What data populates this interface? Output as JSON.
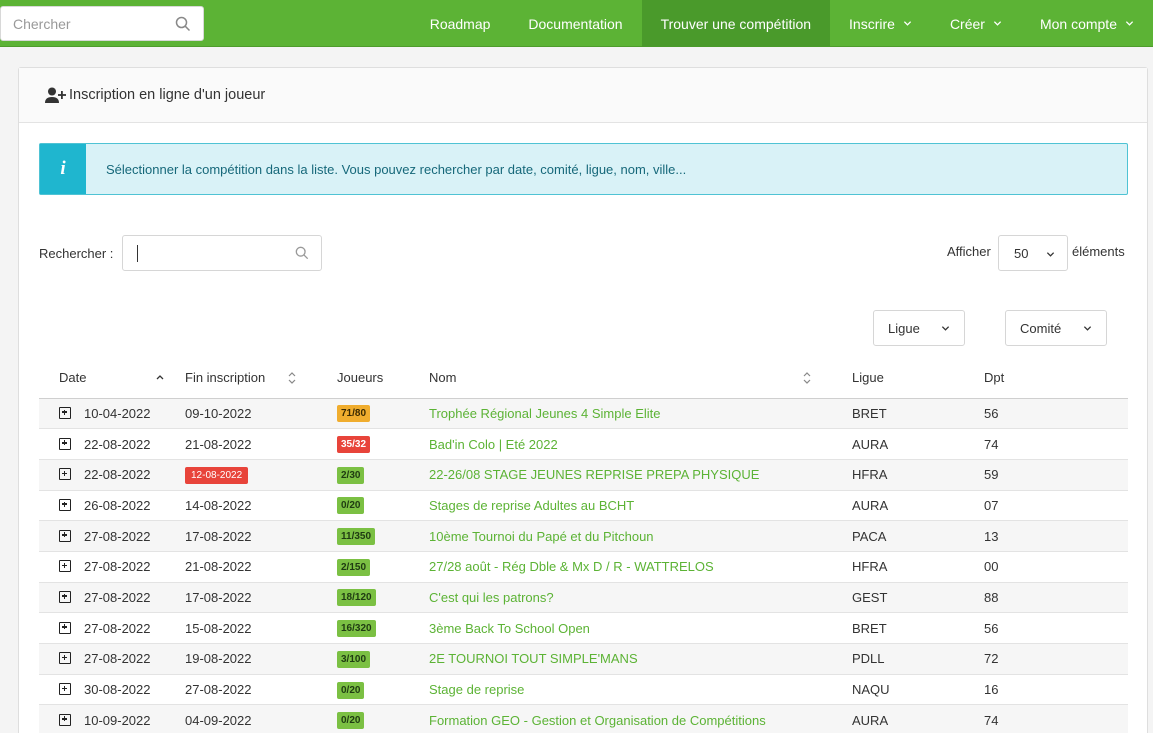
{
  "nav": {
    "search_placeholder": "Chercher",
    "items": [
      {
        "label": "Roadmap",
        "active": false,
        "dropdown": false
      },
      {
        "label": "Documentation",
        "active": false,
        "dropdown": false
      },
      {
        "label": "Trouver une compétition",
        "active": true,
        "dropdown": false
      },
      {
        "label": "Inscrire",
        "active": false,
        "dropdown": true
      },
      {
        "label": "Créer",
        "active": false,
        "dropdown": true
      },
      {
        "label": "Mon compte",
        "active": false,
        "dropdown": true
      }
    ]
  },
  "card": {
    "title": "Inscription en ligne d'un joueur",
    "alert_text": "Sélectionner la compétition dans la liste. Vous pouvez rechercher par date, comité, ligue, nom, ville...",
    "search_label": "Rechercher :",
    "search_value": "",
    "show_label": "Afficher",
    "page_length": "50",
    "elements_label": "éléments",
    "filter_ligue": "Ligue",
    "filter_comite": "Comité"
  },
  "table": {
    "columns": [
      "Date",
      "Fin inscription",
      "Joueurs",
      "Nom",
      "Ligue",
      "Dpt"
    ],
    "rows": [
      {
        "date": "10-04-2022",
        "fin": "09-10-2022",
        "fin_expired": false,
        "joueurs": "71/80",
        "status": "orange",
        "nom": "Trophée Régional Jeunes 4 Simple Elite",
        "ligue": "BRET",
        "dpt": "56"
      },
      {
        "date": "22-08-2022",
        "fin": "21-08-2022",
        "fin_expired": false,
        "joueurs": "35/32",
        "status": "red",
        "nom": "Bad'in Colo | Eté 2022",
        "ligue": "AURA",
        "dpt": "74"
      },
      {
        "date": "22-08-2022",
        "fin": "12-08-2022",
        "fin_expired": true,
        "joueurs": "2/30",
        "status": "green",
        "nom": "22-26/08 STAGE JEUNES REPRISE PREPA PHYSIQUE",
        "ligue": "HFRA",
        "dpt": "59"
      },
      {
        "date": "26-08-2022",
        "fin": "14-08-2022",
        "fin_expired": false,
        "joueurs": "0/20",
        "status": "green",
        "nom": "Stages de reprise Adultes au BCHT",
        "ligue": "AURA",
        "dpt": "07"
      },
      {
        "date": "27-08-2022",
        "fin": "17-08-2022",
        "fin_expired": false,
        "joueurs": "11/350",
        "status": "green",
        "nom": "10ème Tournoi du Papé et du Pitchoun",
        "ligue": "PACA",
        "dpt": "13"
      },
      {
        "date": "27-08-2022",
        "fin": "21-08-2022",
        "fin_expired": false,
        "joueurs": "2/150",
        "status": "green",
        "nom": "27/28 août - Rég Dble & Mx D / R - WATTRELOS",
        "ligue": "HFRA",
        "dpt": "00"
      },
      {
        "date": "27-08-2022",
        "fin": "17-08-2022",
        "fin_expired": false,
        "joueurs": "18/120",
        "status": "green",
        "nom": "C'est qui les patrons?",
        "ligue": "GEST",
        "dpt": "88"
      },
      {
        "date": "27-08-2022",
        "fin": "15-08-2022",
        "fin_expired": false,
        "joueurs": "16/320",
        "status": "green",
        "nom": "3ème Back To School Open",
        "ligue": "BRET",
        "dpt": "56"
      },
      {
        "date": "27-08-2022",
        "fin": "19-08-2022",
        "fin_expired": false,
        "joueurs": "3/100",
        "status": "green",
        "nom": "2E TOURNOI TOUT SIMPLE'MANS",
        "ligue": "PDLL",
        "dpt": "72"
      },
      {
        "date": "30-08-2022",
        "fin": "27-08-2022",
        "fin_expired": false,
        "joueurs": "0/20",
        "status": "green",
        "nom": "Stage de reprise",
        "ligue": "NAQU",
        "dpt": "16"
      },
      {
        "date": "10-09-2022",
        "fin": "04-09-2022",
        "fin_expired": false,
        "joueurs": "0/20",
        "status": "green",
        "nom": "Formation GEO - Gestion et Organisation de Compétitions",
        "ligue": "AURA",
        "dpt": "74"
      }
    ]
  },
  "colors": {
    "brand_green": "#5cb335",
    "active_nav": "#4a9a2b",
    "info_blue": "#1fb6cf",
    "pill_green": "#7bc043",
    "pill_orange": "#f0ad2e",
    "pill_red": "#e8443a"
  }
}
